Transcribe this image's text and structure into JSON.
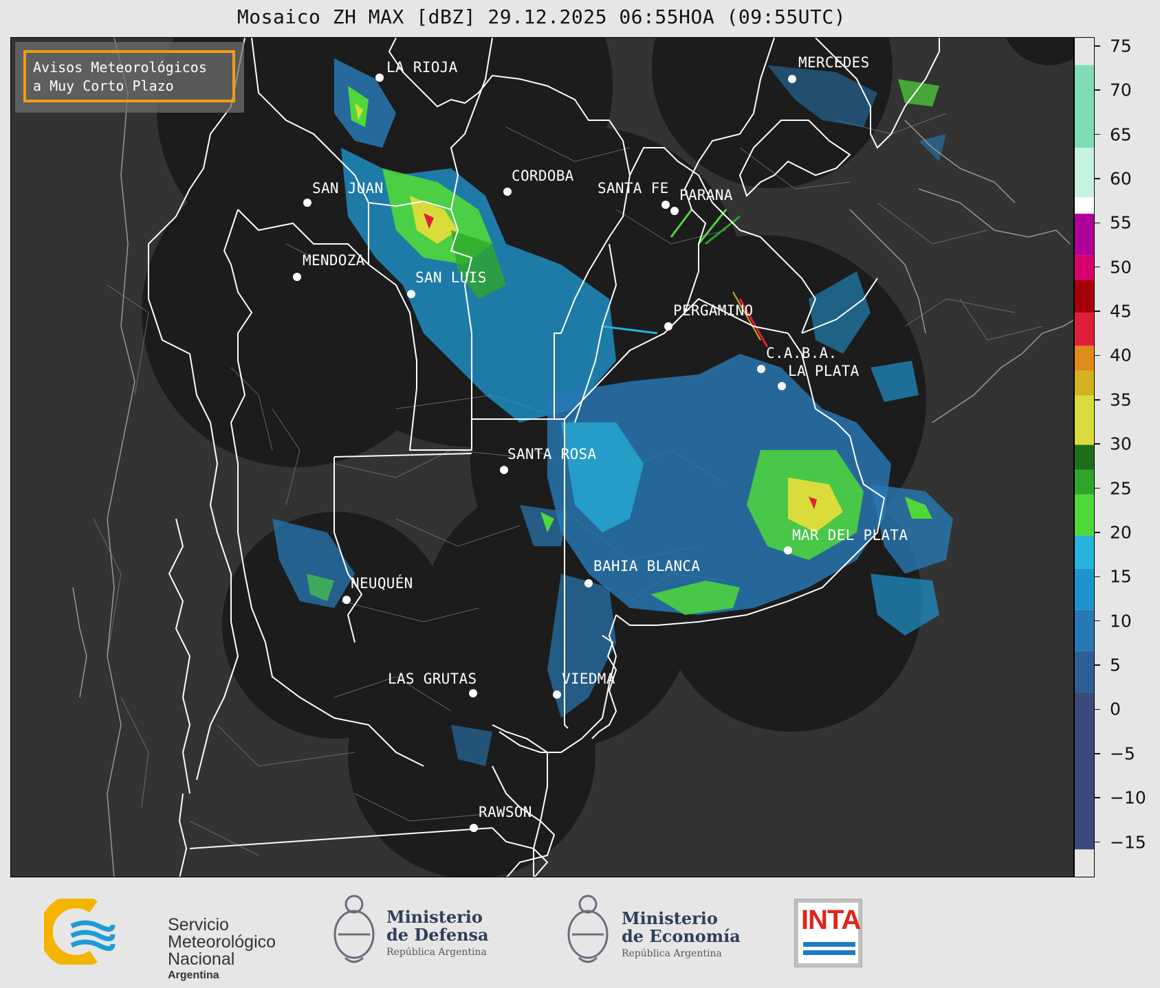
{
  "title": "Mosaico ZH MAX [dBZ] 29.12.2025 06:55HOA (09:55UTC)",
  "warning_box": {
    "line1": "Avisos Meteorológicos",
    "line2": "a Muy Corto Plazo",
    "border_color": "#f39c12"
  },
  "cities": [
    {
      "id": "la-rioja",
      "label": "LA RIOJA"
    },
    {
      "id": "cordoba",
      "label": "CORDOBA"
    },
    {
      "id": "san-juan",
      "label": "SAN JUAN"
    },
    {
      "id": "santa-fe",
      "label": "SANTA FE"
    },
    {
      "id": "parana",
      "label": "PARANA"
    },
    {
      "id": "mendoza",
      "label": "MENDOZA"
    },
    {
      "id": "san-luis",
      "label": "SAN LUIS"
    },
    {
      "id": "pergamino",
      "label": "PERGAMINO"
    },
    {
      "id": "caba",
      "label": "C.A.B.A."
    },
    {
      "id": "la-plata",
      "label": "LA PLATA"
    },
    {
      "id": "santa-rosa",
      "label": "SANTA ROSA"
    },
    {
      "id": "mar-del-plata",
      "label": "MAR DEL PLATA"
    },
    {
      "id": "bahia-blanca",
      "label": "BAHIA BLANCA"
    },
    {
      "id": "neuquen",
      "label": "NEUQUÉN"
    },
    {
      "id": "las-grutas",
      "label": "LAS GRUTAS"
    },
    {
      "id": "viedma",
      "label": "VIEDMA"
    },
    {
      "id": "rawson",
      "label": "RAWSON"
    },
    {
      "id": "mercedes",
      "label": "MERCEDES"
    }
  ],
  "colorbar": {
    "unit": "dBZ",
    "min": -19,
    "max": 76,
    "ticks": [
      "75",
      "70",
      "65",
      "60",
      "55",
      "50",
      "45",
      "40",
      "35",
      "30",
      "25",
      "20",
      "15",
      "10",
      "5",
      "0",
      "−5",
      "−10",
      "−15"
    ],
    "tick_values": [
      75,
      70,
      65,
      60,
      55,
      50,
      45,
      40,
      35,
      30,
      25,
      20,
      15,
      10,
      5,
      0,
      -5,
      -10,
      -15
    ],
    "bands": [
      {
        "from": -19,
        "to": 0,
        "color": "#3a4a7a"
      },
      {
        "from": 0,
        "to": 5,
        "color": "#2f5e96"
      },
      {
        "from": 5,
        "to": 10,
        "color": "#2878b4"
      },
      {
        "from": 10,
        "to": 15,
        "color": "#1f93cc"
      },
      {
        "from": 15,
        "to": 19,
        "color": "#26b3dc"
      },
      {
        "from": 19,
        "to": 24,
        "color": "#4fd83a"
      },
      {
        "from": 24,
        "to": 27,
        "color": "#2fa62a"
      },
      {
        "from": 27,
        "to": 30,
        "color": "#1e6e1e"
      },
      {
        "from": 30,
        "to": 36,
        "color": "#d9dc3a"
      },
      {
        "from": 36,
        "to": 39,
        "color": "#d4b21e"
      },
      {
        "from": 39,
        "to": 42,
        "color": "#e08a1a"
      },
      {
        "from": 42,
        "to": 46,
        "color": "#e0203a"
      },
      {
        "from": 46,
        "to": 50,
        "color": "#a8000a"
      },
      {
        "from": 50,
        "to": 53,
        "color": "#d8006a"
      },
      {
        "from": 53,
        "to": 58,
        "color": "#b0009a"
      },
      {
        "from": 58,
        "to": 60,
        "color": "#ffffff"
      },
      {
        "from": 60,
        "to": 66,
        "color": "#c8f2e0"
      },
      {
        "from": 66,
        "to": 76,
        "color": "#7fdcb4"
      }
    ]
  },
  "logos": {
    "smn": {
      "line1": "Servicio",
      "line2": "Meteorológico",
      "line3": "Nacional",
      "line4": "Argentina"
    },
    "defensa": {
      "line1": "Ministerio",
      "line2": "de Defensa",
      "line3": "República Argentina"
    },
    "economia": {
      "line1": "Ministerio",
      "line2": "de Economía",
      "line3": "República Argentina"
    },
    "inta": {
      "label": "INTA"
    }
  },
  "colors": {
    "map_background": "#333333",
    "radar_coverage": "#1c1c1c",
    "boundary": "#ffffff",
    "district_lines": "#7a7a7a"
  }
}
